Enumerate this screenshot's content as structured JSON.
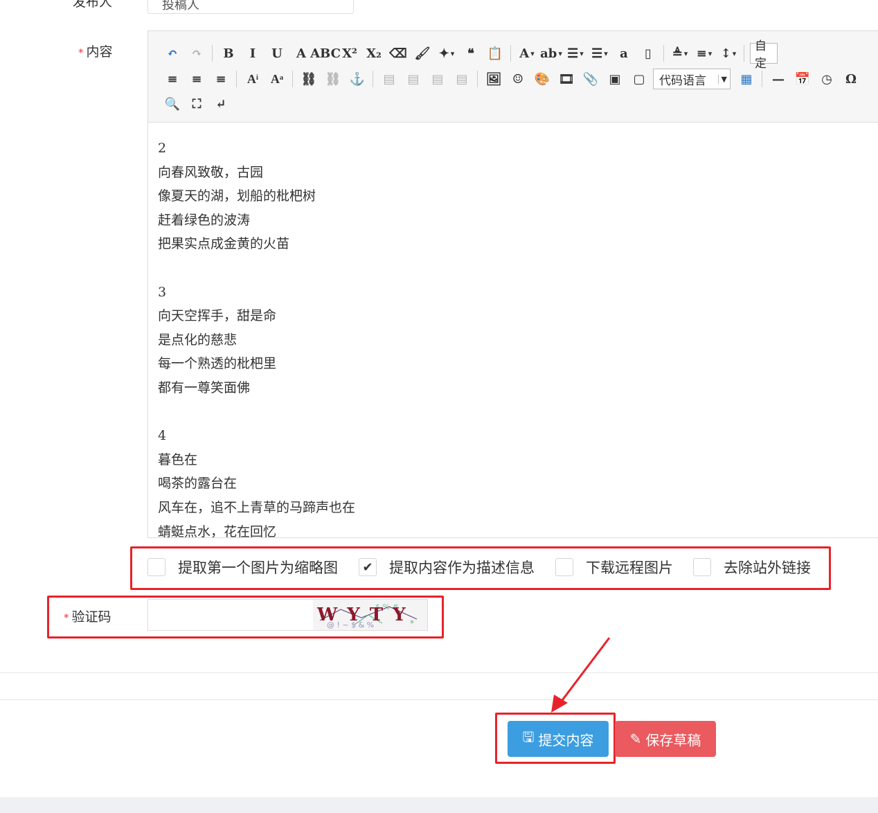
{
  "publisher": {
    "label": "发布人",
    "value": "投稿人"
  },
  "content_field": {
    "required_mark": "*",
    "label": "内容"
  },
  "toolbar": {
    "row1": [
      {
        "name": "undo-icon",
        "glyph": "↶"
      },
      {
        "name": "redo-icon",
        "glyph": "↷"
      },
      {
        "name": "bold-icon",
        "glyph": "B"
      },
      {
        "name": "italic-icon",
        "glyph": "I"
      },
      {
        "name": "underline-icon",
        "glyph": "U"
      },
      {
        "name": "font-border-icon",
        "glyph": "A"
      },
      {
        "name": "strikethrough-icon",
        "glyph": "ABC"
      },
      {
        "name": "superscript-icon",
        "glyph": "X²"
      },
      {
        "name": "subscript-icon",
        "glyph": "X₂"
      },
      {
        "name": "eraser-icon",
        "glyph": "⌫"
      },
      {
        "name": "format-brush-icon",
        "glyph": "🖌"
      },
      {
        "name": "auto-format-icon",
        "glyph": "✦"
      },
      {
        "name": "blockquote-icon",
        "glyph": "❝"
      },
      {
        "name": "paste-text-icon",
        "glyph": "📋"
      },
      {
        "name": "font-color-icon",
        "glyph": "A"
      },
      {
        "name": "highlight-color-icon",
        "glyph": "ab"
      },
      {
        "name": "ordered-list-icon",
        "glyph": "☰"
      },
      {
        "name": "unordered-list-icon",
        "glyph": "☰"
      },
      {
        "name": "select-all-icon",
        "glyph": "a"
      },
      {
        "name": "clear-doc-icon",
        "glyph": "▯"
      },
      {
        "name": "paragraph-spacing-top-icon",
        "glyph": "≜"
      },
      {
        "name": "paragraph-spacing-bottom-icon",
        "glyph": "≡"
      },
      {
        "name": "line-height-icon",
        "glyph": "↕"
      }
    ],
    "auto_label": "自定",
    "row2": [
      {
        "name": "align-center-icon",
        "glyph": "≡"
      },
      {
        "name": "align-right-icon",
        "glyph": "≡"
      },
      {
        "name": "align-justify-icon",
        "glyph": "≡"
      },
      {
        "name": "indent-icon",
        "glyph": "Aͥ"
      },
      {
        "name": "text-direction-icon",
        "glyph": "Aͣ"
      },
      {
        "name": "link-icon",
        "glyph": "⛓"
      },
      {
        "name": "unlink-icon",
        "glyph": "⛓"
      },
      {
        "name": "anchor-icon",
        "glyph": "⚓"
      },
      {
        "name": "image-none-icon",
        "glyph": "▤"
      },
      {
        "name": "image-left-icon",
        "glyph": "▤"
      },
      {
        "name": "image-right-icon",
        "glyph": "▤"
      },
      {
        "name": "image-center-icon",
        "glyph": "▤"
      },
      {
        "name": "insert-image-icon",
        "glyph": "🖼"
      },
      {
        "name": "emotion-icon",
        "glyph": "☺"
      },
      {
        "name": "scrawl-icon",
        "glyph": "🎨"
      },
      {
        "name": "insert-video-icon",
        "glyph": "🎞"
      },
      {
        "name": "attachment-icon",
        "glyph": "📎"
      },
      {
        "name": "gmap-icon",
        "glyph": "▣"
      },
      {
        "name": "insert-frame-icon",
        "glyph": "▢"
      }
    ],
    "code_language": "代码语言",
    "row2_after": [
      {
        "name": "insert-table-icon",
        "glyph": "▦"
      },
      {
        "name": "horizontal-rule-icon",
        "glyph": "—"
      },
      {
        "name": "date-icon",
        "glyph": "📅"
      },
      {
        "name": "time-icon",
        "glyph": "◷"
      },
      {
        "name": "special-chars-icon",
        "glyph": "Ω"
      }
    ],
    "row3": [
      {
        "name": "preview-icon",
        "glyph": "🔍"
      },
      {
        "name": "search-replace-icon",
        "glyph": "⛶"
      },
      {
        "name": "line-break-icon",
        "glyph": "↵"
      }
    ]
  },
  "editor_lines": [
    "2",
    "向春风致敬，古园",
    "像夏天的湖，划船的枇杷树",
    "赶着绿色的波涛",
    "把果实点成金黄的火苗",
    "",
    "3",
    "向天空挥手，甜是命",
    "是点化的慈悲",
    "每一个熟透的枇杷里",
    "都有一尊笑面佛",
    "",
    "4",
    "暮色在",
    "喝茶的露台在",
    "风车在，追不上青草的马蹄声也在",
    "蜻蜓点水，花在回忆"
  ],
  "options": [
    {
      "label": "提取第一个图片为缩略图",
      "checked": false
    },
    {
      "label": "提取内容作为描述信息",
      "checked": true
    },
    {
      "label": "下载远程图片",
      "checked": false
    },
    {
      "label": "去除站外链接",
      "checked": false
    }
  ],
  "captcha": {
    "required_mark": "*",
    "label": "验证码",
    "value": "",
    "image_text": "WYTY"
  },
  "buttons": {
    "submit": "提交内容",
    "draft": "保存草稿"
  },
  "colors": {
    "submit": "#3c9ee0",
    "draft": "#ea5a5e",
    "highlight": "#e8222a"
  }
}
